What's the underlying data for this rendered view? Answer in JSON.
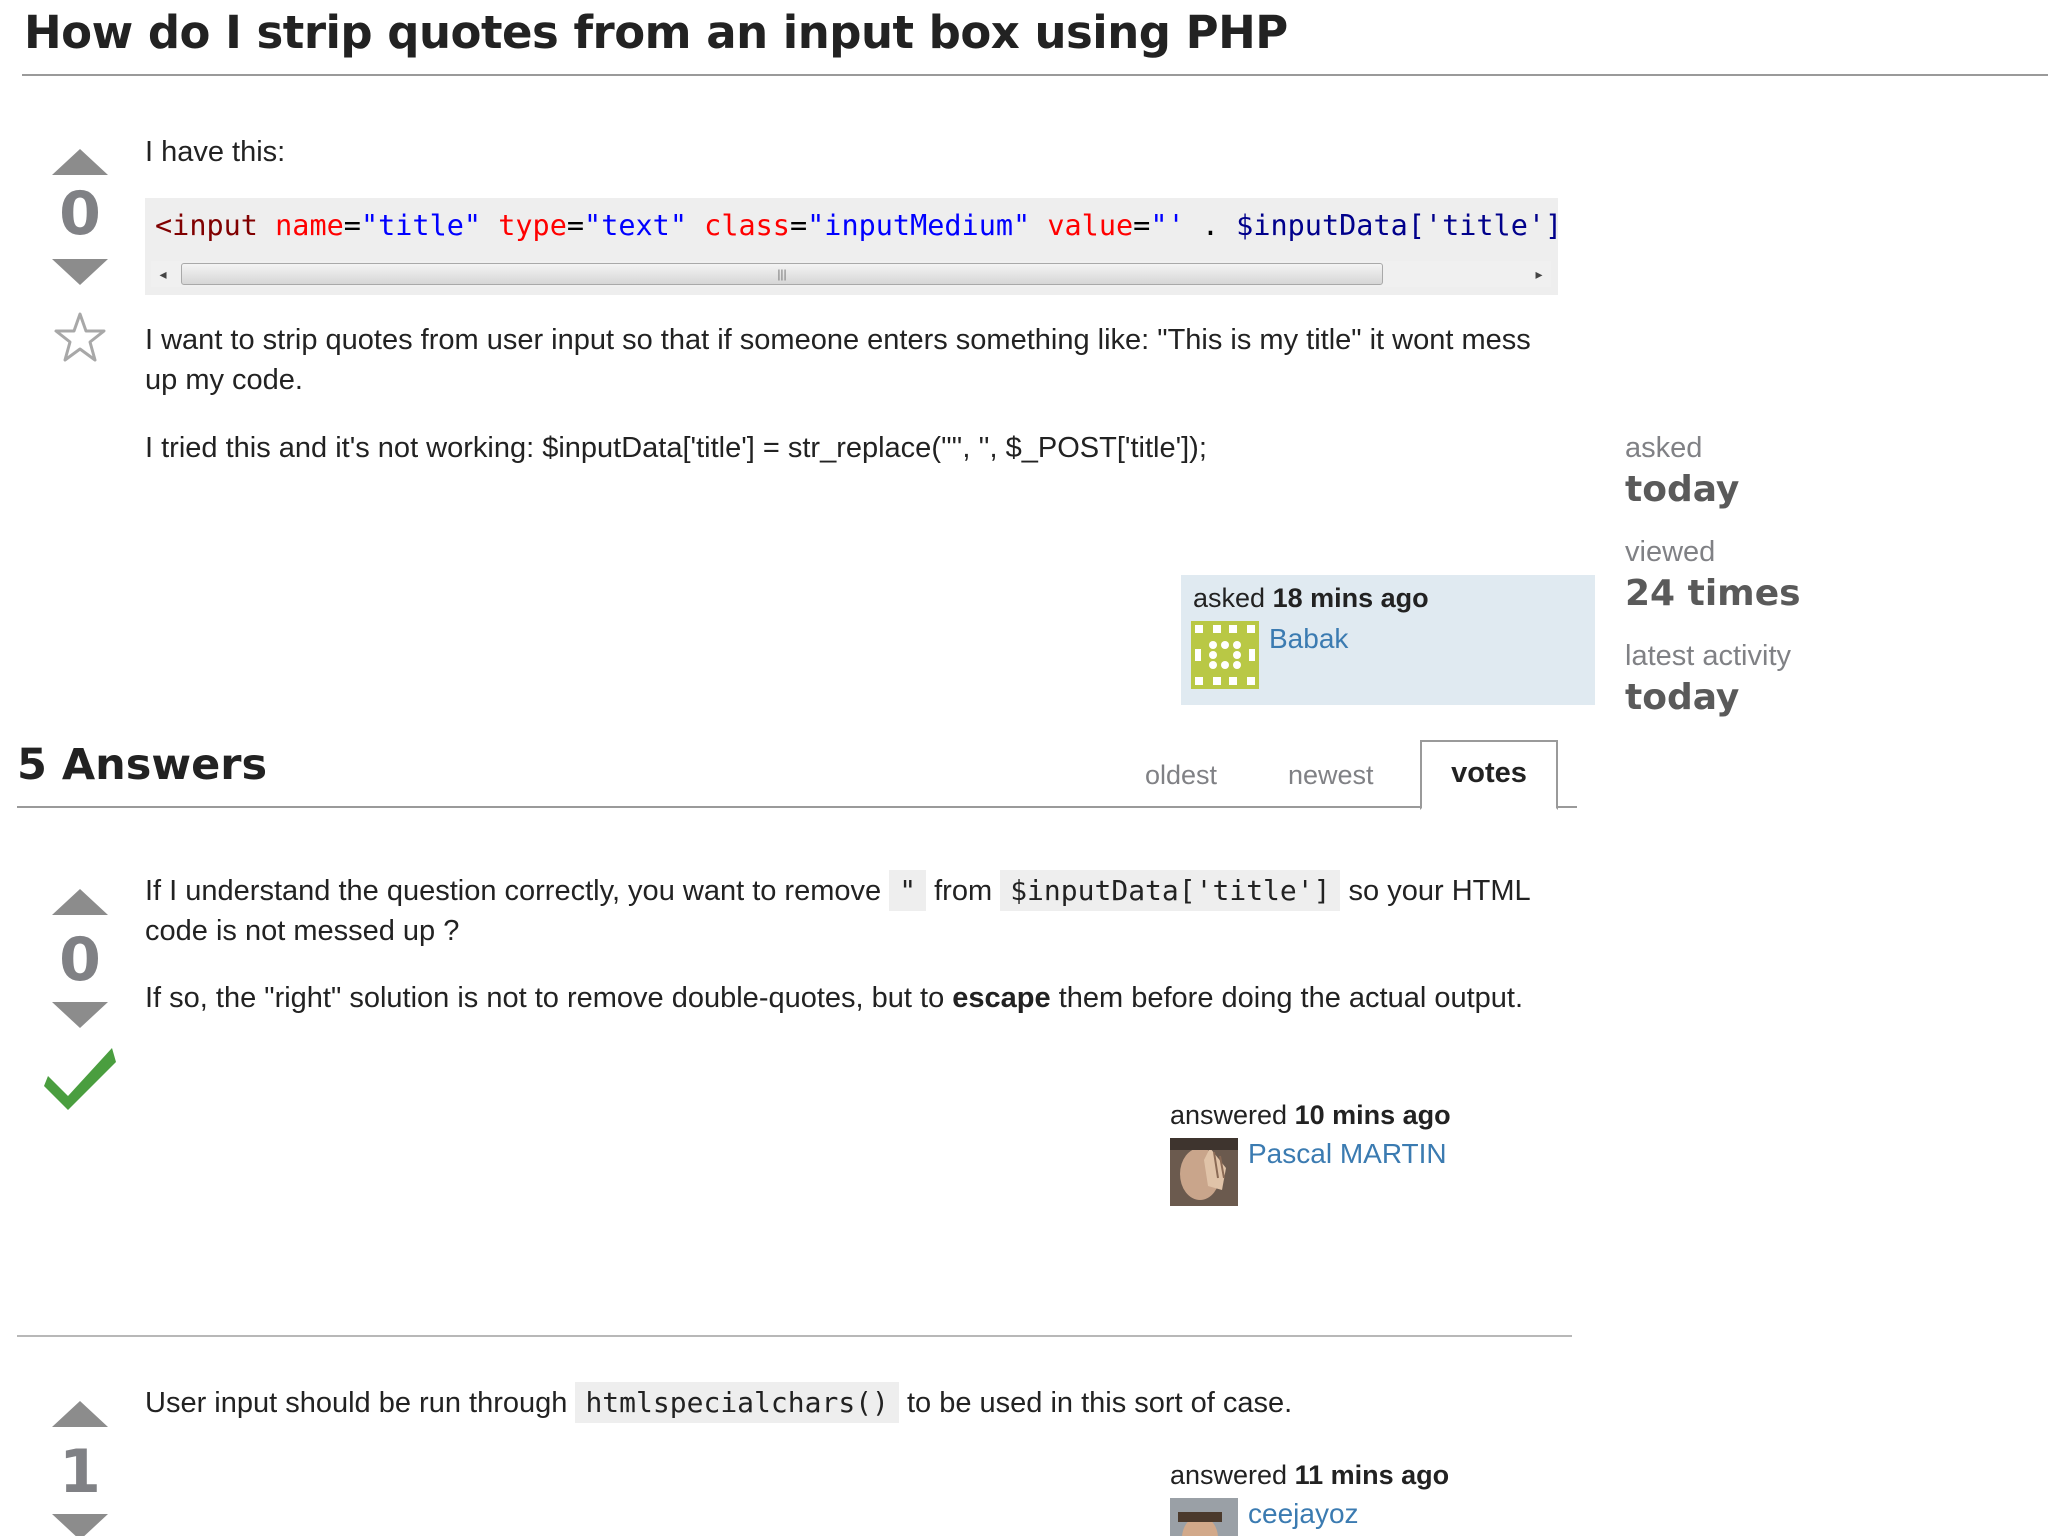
{
  "question": {
    "title": "How do I strip quotes from an input box using PHP",
    "votes": "0",
    "intro": "I have this:",
    "code": {
      "tag_open": "<input",
      "attr_name": "name",
      "val_name": "\"title\"",
      "attr_type": "type",
      "val_type": "\"text\"",
      "attr_class": "class",
      "val_class": "\"inputMedium\"",
      "attr_value": "value",
      "val_value": "\"'",
      "concat": ".",
      "var": "$inputData['title']"
    },
    "para1": "I want to strip quotes from user input so that if someone enters something like: \"This is my title\" it wont mess up my code.",
    "para2": "I tried this and it's not working: $inputData['title'] = str_replace('\"', '', $_POST['title']);",
    "asked_prefix": "asked",
    "asked_time": "18 mins ago",
    "author": "Babak"
  },
  "stats": {
    "asked_label": "asked",
    "asked_value": "today",
    "viewed_label": "viewed",
    "viewed_value": "24 times",
    "activity_label": "latest activity",
    "activity_value": "today"
  },
  "answers_header": {
    "title": "5 Answers",
    "tabs": [
      {
        "label": "oldest"
      },
      {
        "label": "newest"
      },
      {
        "label": "votes"
      }
    ]
  },
  "answers": [
    {
      "votes": "0",
      "p1_a": "If I understand the question correctly, you want to remove",
      "p1_code1": "\"",
      "p1_b": "from",
      "p1_code2": "$inputData['title']",
      "p1_c": "so your HTML code is not messed up ?",
      "p2_a": "If so, the \"right\" solution is not to remove double-quotes, but to",
      "p2_bold": "escape",
      "p2_b": "them before doing the actual output.",
      "action": "answered",
      "time": "10 mins ago",
      "author": "Pascal MARTIN"
    },
    {
      "votes": "1",
      "p1_a": "User input should be run through",
      "p1_code": "htmlspecialchars()",
      "p1_b": "to be used in this sort of case.",
      "action": "answered",
      "time": "11 mins ago",
      "author": "ceejayoz"
    }
  ],
  "colors": {
    "link": "#3b7bb1",
    "vote_arrow": "#8c8c8c",
    "accepted": "#4a9e3f",
    "owner_card_bg": "#e0eaf1"
  }
}
